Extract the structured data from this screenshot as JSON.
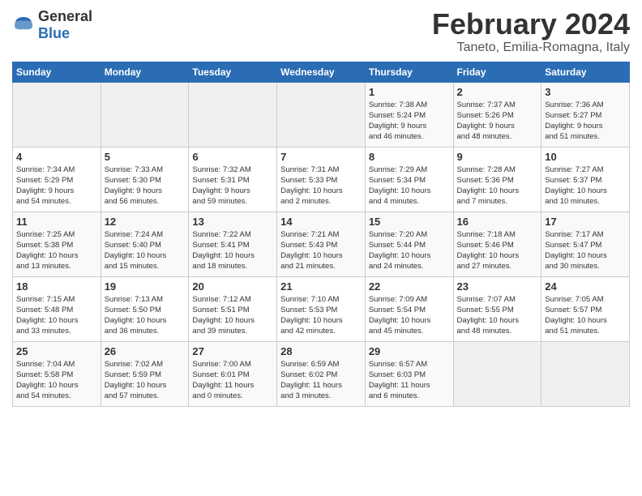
{
  "logo": {
    "general": "General",
    "blue": "Blue"
  },
  "header": {
    "month": "February 2024",
    "location": "Taneto, Emilia-Romagna, Italy"
  },
  "weekdays": [
    "Sunday",
    "Monday",
    "Tuesday",
    "Wednesday",
    "Thursday",
    "Friday",
    "Saturday"
  ],
  "weeks": [
    [
      {
        "day": "",
        "info": ""
      },
      {
        "day": "",
        "info": ""
      },
      {
        "day": "",
        "info": ""
      },
      {
        "day": "",
        "info": ""
      },
      {
        "day": "1",
        "info": "Sunrise: 7:38 AM\nSunset: 5:24 PM\nDaylight: 9 hours\nand 46 minutes."
      },
      {
        "day": "2",
        "info": "Sunrise: 7:37 AM\nSunset: 5:26 PM\nDaylight: 9 hours\nand 48 minutes."
      },
      {
        "day": "3",
        "info": "Sunrise: 7:36 AM\nSunset: 5:27 PM\nDaylight: 9 hours\nand 51 minutes."
      }
    ],
    [
      {
        "day": "4",
        "info": "Sunrise: 7:34 AM\nSunset: 5:29 PM\nDaylight: 9 hours\nand 54 minutes."
      },
      {
        "day": "5",
        "info": "Sunrise: 7:33 AM\nSunset: 5:30 PM\nDaylight: 9 hours\nand 56 minutes."
      },
      {
        "day": "6",
        "info": "Sunrise: 7:32 AM\nSunset: 5:31 PM\nDaylight: 9 hours\nand 59 minutes."
      },
      {
        "day": "7",
        "info": "Sunrise: 7:31 AM\nSunset: 5:33 PM\nDaylight: 10 hours\nand 2 minutes."
      },
      {
        "day": "8",
        "info": "Sunrise: 7:29 AM\nSunset: 5:34 PM\nDaylight: 10 hours\nand 4 minutes."
      },
      {
        "day": "9",
        "info": "Sunrise: 7:28 AM\nSunset: 5:36 PM\nDaylight: 10 hours\nand 7 minutes."
      },
      {
        "day": "10",
        "info": "Sunrise: 7:27 AM\nSunset: 5:37 PM\nDaylight: 10 hours\nand 10 minutes."
      }
    ],
    [
      {
        "day": "11",
        "info": "Sunrise: 7:25 AM\nSunset: 5:38 PM\nDaylight: 10 hours\nand 13 minutes."
      },
      {
        "day": "12",
        "info": "Sunrise: 7:24 AM\nSunset: 5:40 PM\nDaylight: 10 hours\nand 15 minutes."
      },
      {
        "day": "13",
        "info": "Sunrise: 7:22 AM\nSunset: 5:41 PM\nDaylight: 10 hours\nand 18 minutes."
      },
      {
        "day": "14",
        "info": "Sunrise: 7:21 AM\nSunset: 5:43 PM\nDaylight: 10 hours\nand 21 minutes."
      },
      {
        "day": "15",
        "info": "Sunrise: 7:20 AM\nSunset: 5:44 PM\nDaylight: 10 hours\nand 24 minutes."
      },
      {
        "day": "16",
        "info": "Sunrise: 7:18 AM\nSunset: 5:46 PM\nDaylight: 10 hours\nand 27 minutes."
      },
      {
        "day": "17",
        "info": "Sunrise: 7:17 AM\nSunset: 5:47 PM\nDaylight: 10 hours\nand 30 minutes."
      }
    ],
    [
      {
        "day": "18",
        "info": "Sunrise: 7:15 AM\nSunset: 5:48 PM\nDaylight: 10 hours\nand 33 minutes."
      },
      {
        "day": "19",
        "info": "Sunrise: 7:13 AM\nSunset: 5:50 PM\nDaylight: 10 hours\nand 36 minutes."
      },
      {
        "day": "20",
        "info": "Sunrise: 7:12 AM\nSunset: 5:51 PM\nDaylight: 10 hours\nand 39 minutes."
      },
      {
        "day": "21",
        "info": "Sunrise: 7:10 AM\nSunset: 5:53 PM\nDaylight: 10 hours\nand 42 minutes."
      },
      {
        "day": "22",
        "info": "Sunrise: 7:09 AM\nSunset: 5:54 PM\nDaylight: 10 hours\nand 45 minutes."
      },
      {
        "day": "23",
        "info": "Sunrise: 7:07 AM\nSunset: 5:55 PM\nDaylight: 10 hours\nand 48 minutes."
      },
      {
        "day": "24",
        "info": "Sunrise: 7:05 AM\nSunset: 5:57 PM\nDaylight: 10 hours\nand 51 minutes."
      }
    ],
    [
      {
        "day": "25",
        "info": "Sunrise: 7:04 AM\nSunset: 5:58 PM\nDaylight: 10 hours\nand 54 minutes."
      },
      {
        "day": "26",
        "info": "Sunrise: 7:02 AM\nSunset: 5:59 PM\nDaylight: 10 hours\nand 57 minutes."
      },
      {
        "day": "27",
        "info": "Sunrise: 7:00 AM\nSunset: 6:01 PM\nDaylight: 11 hours\nand 0 minutes."
      },
      {
        "day": "28",
        "info": "Sunrise: 6:59 AM\nSunset: 6:02 PM\nDaylight: 11 hours\nand 3 minutes."
      },
      {
        "day": "29",
        "info": "Sunrise: 6:57 AM\nSunset: 6:03 PM\nDaylight: 11 hours\nand 6 minutes."
      },
      {
        "day": "",
        "info": ""
      },
      {
        "day": "",
        "info": ""
      }
    ]
  ]
}
